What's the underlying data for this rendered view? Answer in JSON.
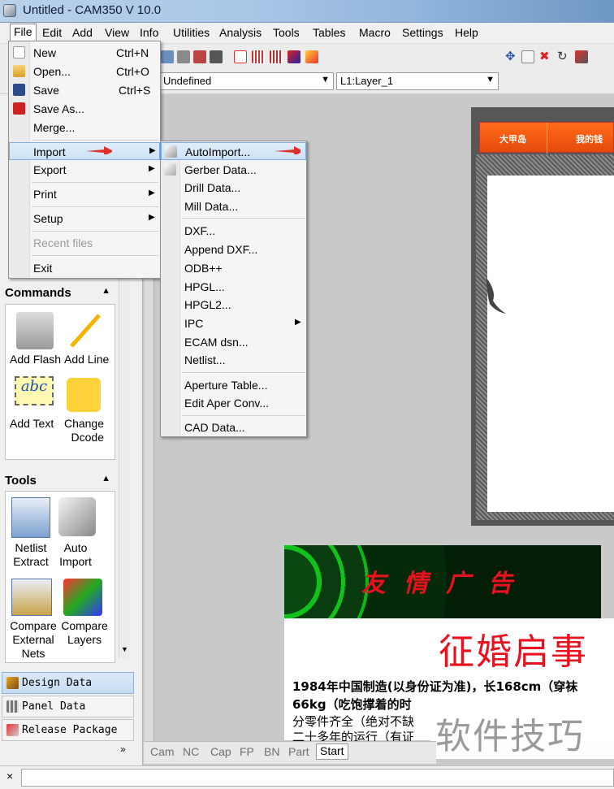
{
  "window": {
    "title": "Untitled - CAM350 V 10.0"
  },
  "menubar": [
    "File",
    "Edit",
    "Add",
    "View",
    "Info",
    "Utilities",
    "Analysis",
    "Tools",
    "Tables",
    "Macro",
    "Settings",
    "Help"
  ],
  "toolbar": {
    "layer_combo_left": "Undefined",
    "layer_combo_right": "L1:Layer_1"
  },
  "file_menu": {
    "items": [
      {
        "label": "New",
        "shortcut": "Ctrl+N"
      },
      {
        "label": "Open...",
        "shortcut": "Ctrl+O"
      },
      {
        "label": "Save",
        "shortcut": "Ctrl+S"
      },
      {
        "label": "Save As...",
        "shortcut": ""
      },
      {
        "label": "Merge...",
        "shortcut": ""
      },
      {
        "label": "Import",
        "shortcut": ""
      },
      {
        "label": "Export",
        "shortcut": ""
      },
      {
        "label": "Print",
        "shortcut": ""
      },
      {
        "label": "Setup",
        "shortcut": ""
      },
      {
        "label": "Recent files",
        "shortcut": ""
      },
      {
        "label": "Exit",
        "shortcut": ""
      }
    ]
  },
  "import_menu": {
    "items": [
      "AutoImport...",
      "Gerber Data...",
      "Drill Data...",
      "Mill Data...",
      "DXF...",
      "Append DXF...",
      "ODB++",
      "HPGL...",
      "HPGL2...",
      "IPC",
      "ECAM dsn...",
      "Netlist...",
      "Aperture Table...",
      "Edit Aper Conv...",
      "CAD Data..."
    ]
  },
  "left_panel": {
    "commands_title": "Commands",
    "commands": [
      "Add Flash",
      "Add Line",
      "Add Text",
      "Change Dcode"
    ],
    "tools_title": "Tools",
    "tools": [
      "Netlist Extract",
      "Auto Import",
      "Compare External Nets",
      "Compare Layers"
    ],
    "nav": [
      "Design Data",
      "Panel Data",
      "Release Package"
    ]
  },
  "bottom_tabs": [
    "Cam",
    "NC",
    "Cap",
    "FP",
    "BN",
    "Part",
    "Start"
  ],
  "active_tab": "Start",
  "canvas": {
    "ad_tab_1": "大甲岛",
    "ad_tab_2": "我的钱",
    "banner_text": "友情广告",
    "doc_title": "征婚启事",
    "doc_lines": [
      "1984年中国制造(以身份证为准)，长168cm（穿袜",
      "66kg（吃饱撑着的时",
      "分零件齐全（绝对不缺",
      "二十多年的运行（有证"
    ],
    "watermark": "软件技巧"
  },
  "statusbar": {
    "close_glyph": "×"
  }
}
